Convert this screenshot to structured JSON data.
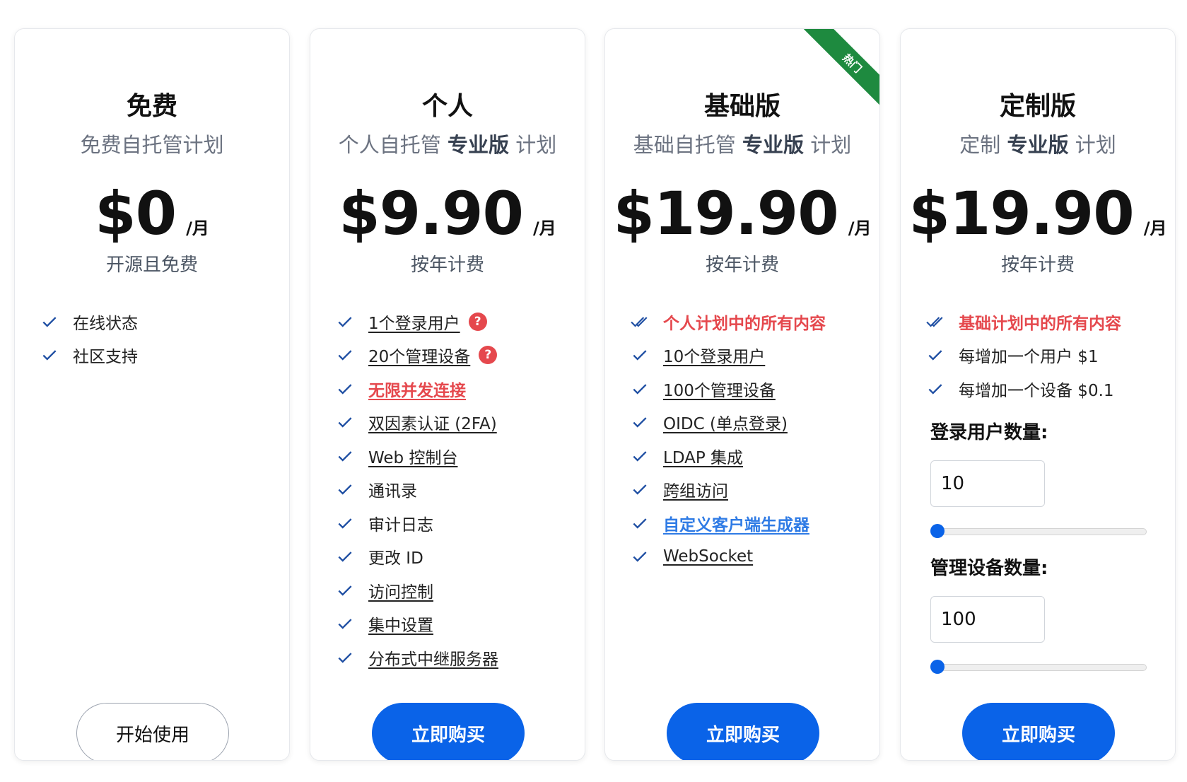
{
  "plans": [
    {
      "title": "免费",
      "subtitle_pre": "免费自托管计划",
      "subtitle_bold": "",
      "subtitle_post": "",
      "price": "$0",
      "period": "/月",
      "note": "开源且免费",
      "features": [
        "在线状态",
        "社区支持"
      ],
      "button": "开始使用"
    },
    {
      "title": "个人",
      "subtitle_pre": "个人自托管",
      "subtitle_bold": "专业版",
      "subtitle_post": "计划",
      "price": "$9.90",
      "period": "/月",
      "note": "按年计费",
      "features": [
        "1个登录用户",
        "20个管理设备",
        "无限并发连接",
        "双因素认证 (2FA)",
        "Web 控制台",
        "通讯录",
        "审计日志",
        "更改 ID",
        "访问控制",
        "集中设置",
        "分布式中继服务器"
      ],
      "help_mark": "?",
      "button": "立即购买"
    },
    {
      "title": "基础版",
      "subtitle_pre": "基础自托管",
      "subtitle_bold": "专业版",
      "subtitle_post": "计划",
      "price": "$19.90",
      "period": "/月",
      "note": "按年计费",
      "features": [
        "个人计划中的所有内容",
        "10个登录用户",
        "100个管理设备",
        "OIDC (单点登录)",
        "LDAP 集成",
        "跨组访问",
        "自定义客户端生成器",
        "WebSocket"
      ],
      "ribbon": "热门",
      "button": "立即购买"
    },
    {
      "title": "定制版",
      "subtitle_pre": "定制",
      "subtitle_bold": "专业版",
      "subtitle_post": "计划",
      "price": "$19.90",
      "period": "/月",
      "note": "按年计费",
      "features": [
        "基础计划中的所有内容",
        "每增加一个用户 $1",
        "每增加一个设备 $0.1"
      ],
      "users_label": "登录用户数量:",
      "users_value": "10",
      "users_slider": 0,
      "devices_label": "管理设备数量:",
      "devices_value": "100",
      "devices_slider": 0,
      "button": "立即购买"
    }
  ],
  "colors": {
    "accent": "#0a63e8",
    "check": "#1f4fa3",
    "highlight_red": "#e5484d",
    "highlight_blue": "#2f7be5",
    "ribbon": "#1e8a3f"
  }
}
